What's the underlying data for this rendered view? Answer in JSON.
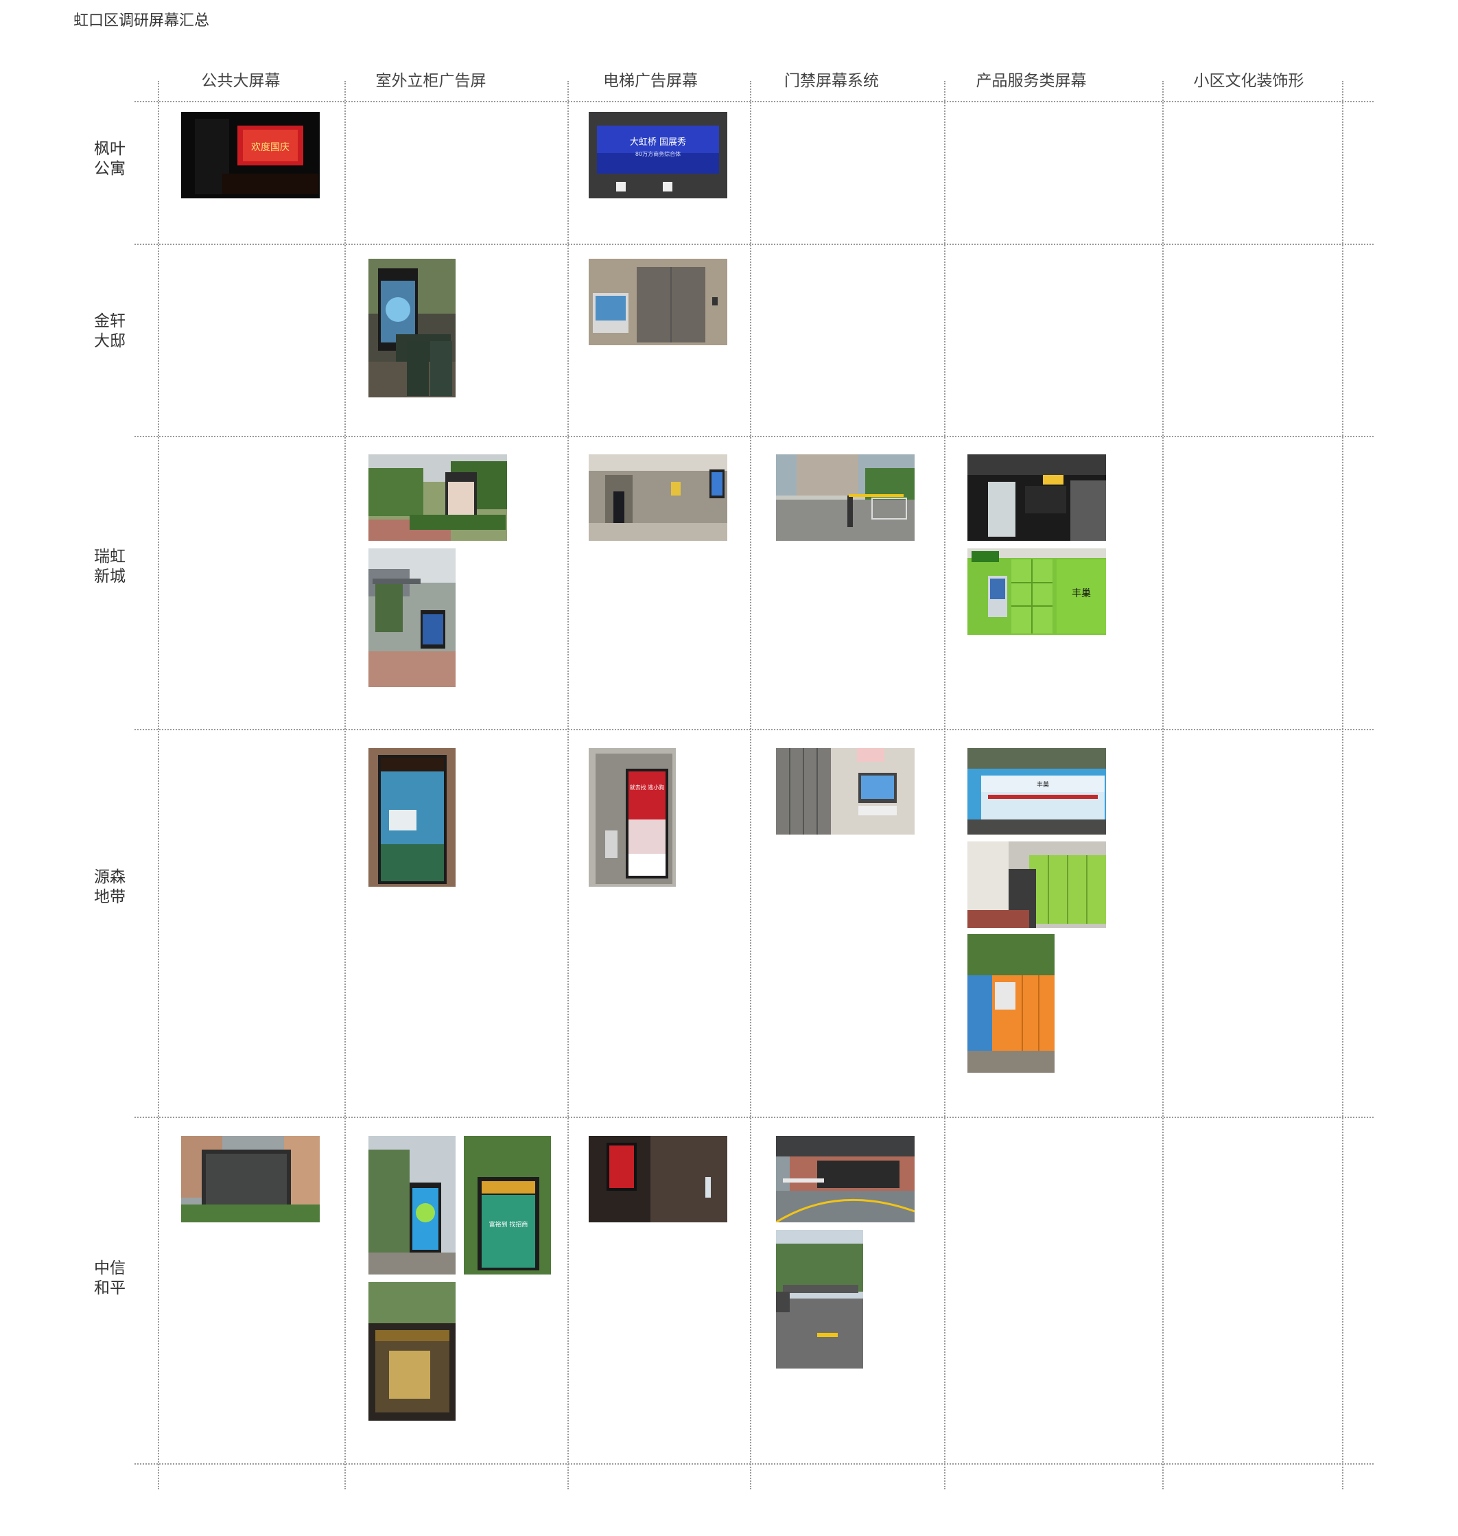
{
  "page": {
    "title": "虹口区调研屏幕汇总"
  },
  "columns": [
    "公共大屏幕",
    "室外立柜广告屏",
    "电梯广告屏幕",
    "门禁屏幕系统",
    "产品服务类屏幕",
    "小区文化装饰形"
  ],
  "rows": [
    {
      "line1": "枫叶",
      "line2": "公寓"
    },
    {
      "line1": "金轩",
      "line2": "大邸"
    },
    {
      "line1": "瑞虹",
      "line2": "新城"
    },
    {
      "line1": "源森",
      "line2": "地带"
    },
    {
      "line1": "中信",
      "line2": "和平"
    }
  ],
  "photos": {
    "fengye_public_screen": {
      "text": "欢度国庆"
    },
    "fengye_elevator_screen": {
      "headline": "大虹桥  国展秀",
      "subline": "80万方商务综合体"
    },
    "yuansen_elevator_screen": {
      "headline": "就去找 逃小狗"
    },
    "yuansen_service_screen": {
      "text": "丰巢"
    },
    "ruihong_locker": {
      "text": "丰巢"
    },
    "zhongxin_outdoor_b": {
      "text": "富裕到 找招商"
    }
  },
  "colors": {
    "grid_line": "#9a9a9a",
    "locker_green": "#7cc43b",
    "locker_orange": "#f08a2c",
    "screen_blue": "#2a3fc4"
  }
}
